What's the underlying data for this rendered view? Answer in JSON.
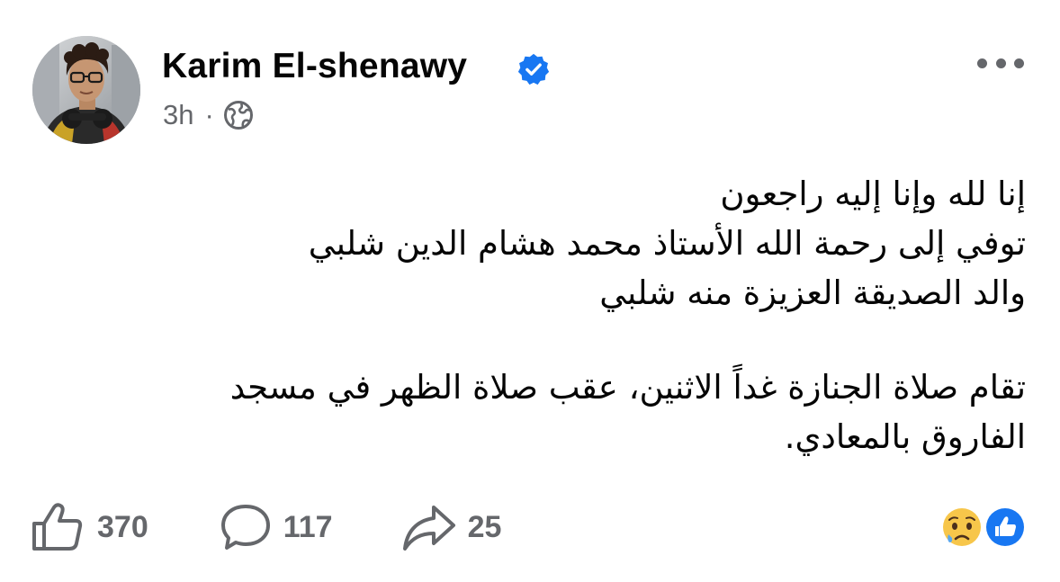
{
  "author": {
    "name": "Karim El-shenawy",
    "verified": true
  },
  "meta": {
    "time": "3h",
    "separator": "·",
    "audience_icon": "globe-icon"
  },
  "post": {
    "lines": [
      "إنا لله وإنا إليه راجعون",
      "توفي إلى رحمة الله الأستاذ محمد هشام الدين شلبي",
      "والد الصديقة العزيزة منه شلبي",
      "تقام صلاة الجنازة غداً الاثنين،  عقب صلاة الظهر في مسجد",
      "الفاروق بالمعادي."
    ]
  },
  "actions": {
    "likes": "370",
    "comments": "117",
    "shares": "25"
  },
  "reactions": [
    "sad-icon",
    "like-icon"
  ],
  "colors": {
    "text": "#050505",
    "secondary": "#65676b",
    "verified": "#1877f2",
    "like_badge": "#1877f2",
    "sad_face": "#f7c64a"
  }
}
